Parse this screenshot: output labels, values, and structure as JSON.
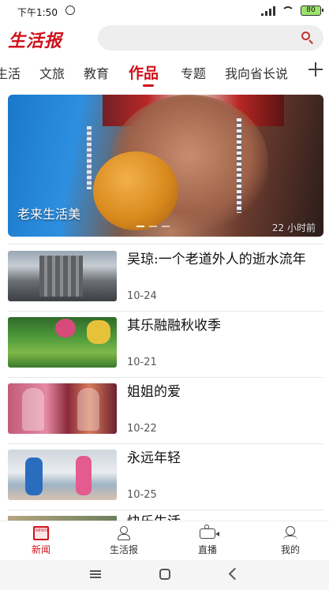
{
  "status": {
    "time": "下午1:50",
    "battery": "80"
  },
  "header": {
    "logo": "生活报"
  },
  "tabs": [
    "生活",
    "文旅",
    "教育",
    "作品",
    "专题",
    "我向省长说"
  ],
  "active_tab": "作品",
  "hero": {
    "title": "老来生活美",
    "time": "22 小时前"
  },
  "news": [
    {
      "title": "吴琼:一个老道外人的逝水流年",
      "date": "10-24"
    },
    {
      "title": "其乐融融秋收季",
      "date": "10-21"
    },
    {
      "title": "姐姐的爱",
      "date": "10-22"
    },
    {
      "title": "永远年轻",
      "date": "10-25"
    }
  ],
  "partial_title": "快乐生活",
  "bottom_nav": [
    {
      "label": "新闻"
    },
    {
      "label": "生活报"
    },
    {
      "label": "直播"
    },
    {
      "label": "我的"
    }
  ],
  "colors": {
    "brand": "#d0121b"
  }
}
